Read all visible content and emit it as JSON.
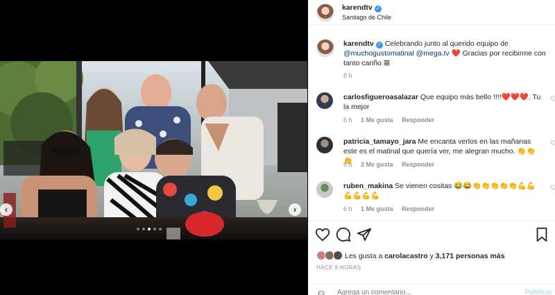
{
  "post": {
    "author": "karendtv",
    "location": "Santiago de Chile",
    "caption_parts": {
      "text1": "Celebrando junto al querido equipo de",
      "mention1": "@muchogustomatinal",
      "mention2": "@mega.tv",
      "text2": "❤️ Gracias por recibirme con tanto cariño 𝌆"
    },
    "caption_time": "8 h",
    "likes_prefix": "Les gusta a",
    "likes_user": "carolacastro",
    "likes_mid": "y",
    "likes_count": "3,171 personas más",
    "time_ago": "HACE 8 HORAS",
    "comment_placeholder": "Agrega un comentario...",
    "publish_label": "Publicar"
  },
  "carousel": {
    "prev_icon": "chevron-left",
    "next_icon": "chevron-right",
    "slide_count": 5,
    "active_slide": 3
  },
  "comments": [
    {
      "user": "carlosfigueroasalazar",
      "text": "Que equipo más bello !!!!❤️❤️❤️. Tu la mejor",
      "time": "6 h",
      "likes": "1 Me gusta",
      "reply": "Responder"
    },
    {
      "user": "patricia_tamayo_jara",
      "text": "Me encanta verlos en las mañanas este es el matinal que quería ver, me alegran mucho. 👏👏👏",
      "time": "8 h",
      "likes": "2 Me gusta",
      "reply": "Responder"
    },
    {
      "user": "ruben_makina",
      "text": "Se vienen cositas 😂😂👏👏👏👏👏💪💪💪💪💪💪",
      "time": "6 h",
      "likes": "1 Me gusta",
      "reply": "Responder"
    }
  ],
  "icons": {
    "verified": "verified-badge",
    "like": "heart-outline",
    "comment": "comment-bubble",
    "share": "paper-plane",
    "emoji": "smiley-face"
  },
  "colors": {
    "link": "#00376b",
    "verified": "#3897f0",
    "muted": "#8e8e8e",
    "publish_disabled": "#b2dffc"
  }
}
